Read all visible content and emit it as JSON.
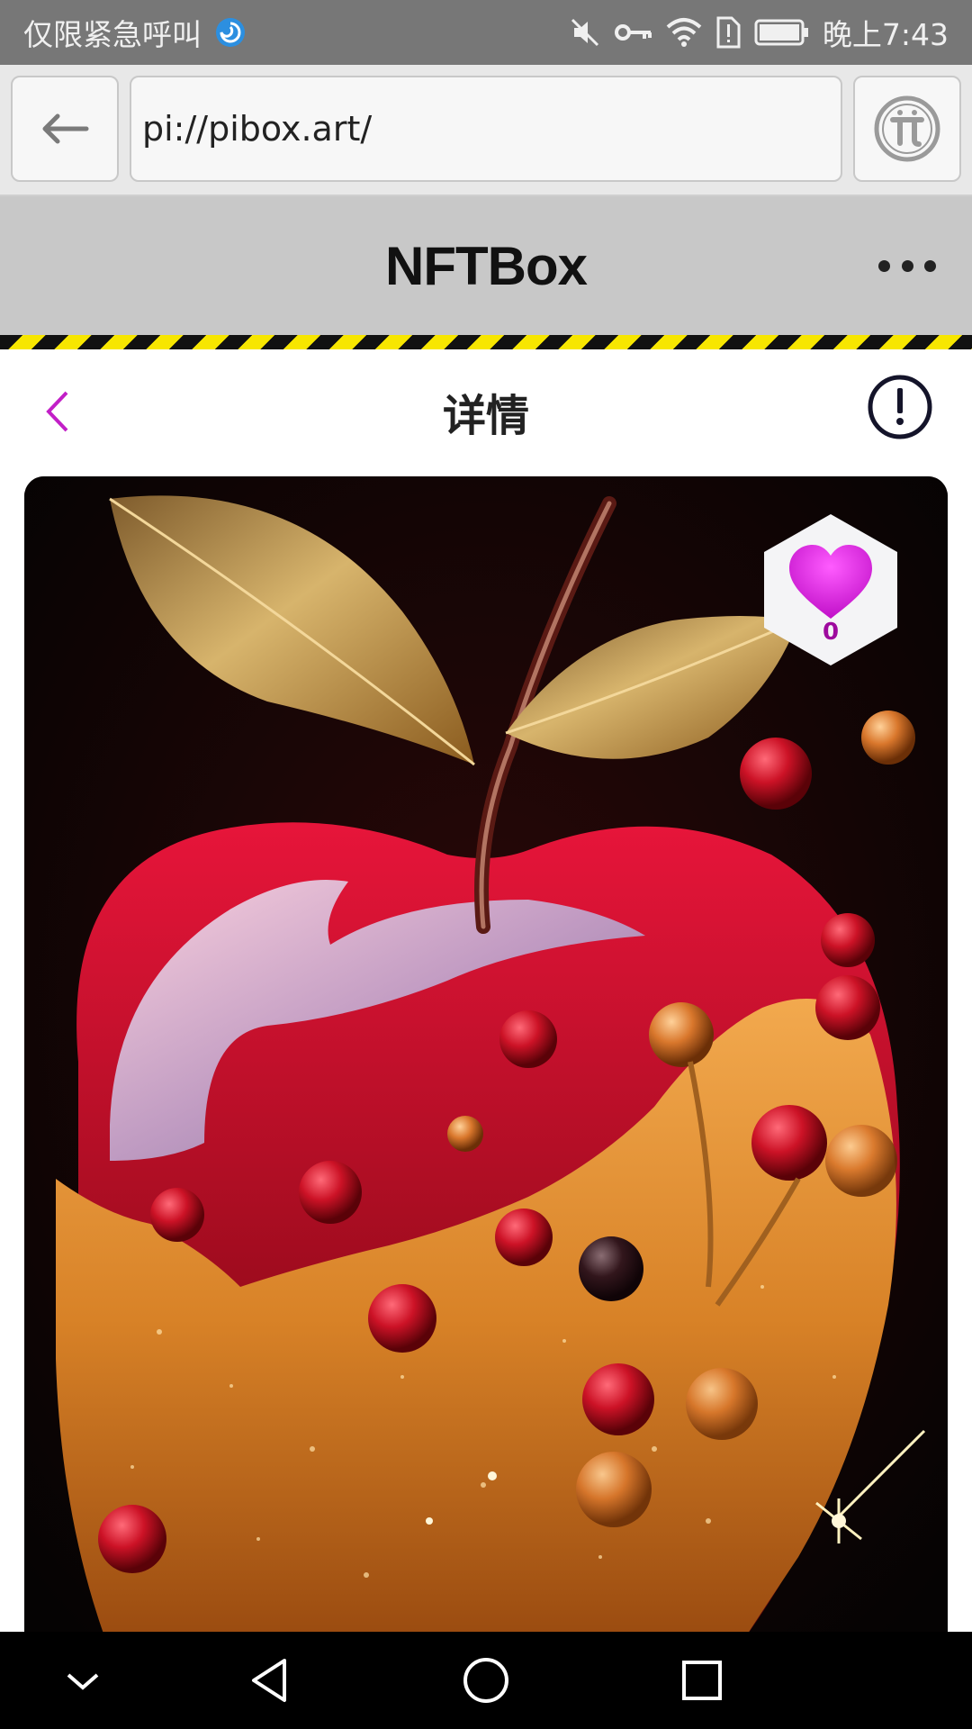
{
  "status_bar": {
    "carrier": "仅限紧急呼叫",
    "time": "晚上7:43"
  },
  "browser": {
    "url": "pi://pibox.art/"
  },
  "app": {
    "title": "NFTBox"
  },
  "page": {
    "title": "详情"
  },
  "artwork": {
    "likes": "0"
  },
  "colors": {
    "accent": "#c21fc7",
    "heart": "#e21ce6",
    "appbar": "#c8c8c8",
    "statusbar": "#777777"
  }
}
